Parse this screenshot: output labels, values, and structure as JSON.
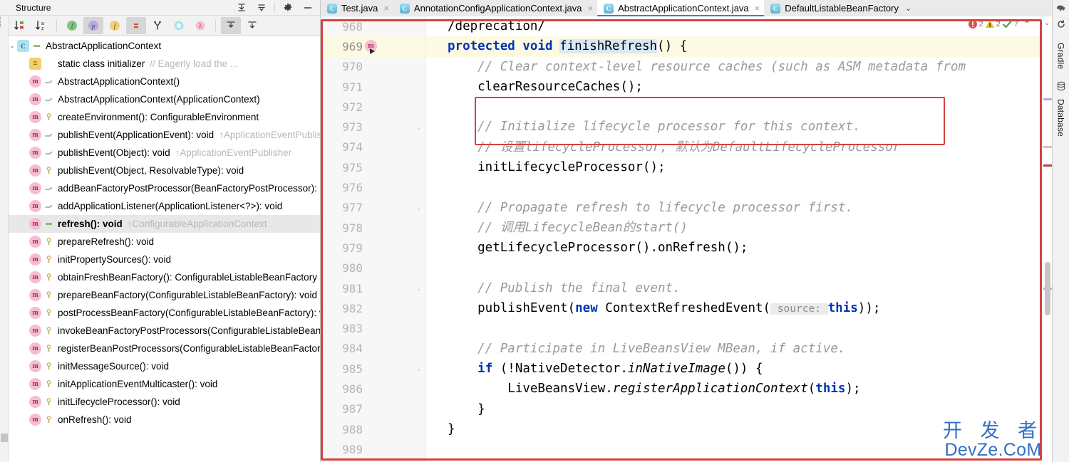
{
  "structure": {
    "title": "Structure",
    "header_actions": [
      {
        "name": "expand-all-icon",
        "glyph": "⇟"
      },
      {
        "name": "collapse-all-icon",
        "glyph": "⇞"
      },
      {
        "name": "settings-gear-icon",
        "glyph": "✲"
      },
      {
        "name": "hide-panel-icon",
        "glyph": "—"
      }
    ],
    "toolbar": [
      {
        "name": "sort-by-visibility-button",
        "glyph": "↓",
        "pressed": false
      },
      {
        "name": "sort-alphabetically-button",
        "glyph": "↓",
        "pressed": false
      },
      {
        "name": "show-inherited-button",
        "glyph": "I",
        "pressed": false
      },
      {
        "name": "show-properties-button",
        "glyph": "p",
        "pressed": true
      },
      {
        "name": "show-fields-button",
        "glyph": "f",
        "pressed": false
      },
      {
        "name": "show-non-public-button",
        "glyph": "=",
        "pressed": true
      },
      {
        "name": "show-anonymous-classes-button",
        "glyph": "Y",
        "pressed": false
      },
      {
        "name": "show-interfaces-button",
        "glyph": "O",
        "pressed": false
      },
      {
        "name": "show-lambdas-button",
        "glyph": "λ",
        "pressed": false
      },
      {
        "name": "expand-all-tree-button",
        "glyph": "⇲",
        "pressed": true
      },
      {
        "name": "collapse-all-tree-button",
        "glyph": "⇱",
        "pressed": false
      }
    ],
    "left_strip_label": "Structure",
    "tree": [
      {
        "kind": "class",
        "mod": "field",
        "label": "AbstractApplicationContext",
        "sub": "",
        "indent": 0,
        "twisty": "v",
        "selected": false
      },
      {
        "kind": "init",
        "mod": "",
        "label": "static class initializer",
        "sub": "// Eagerly load the ...",
        "indent": 1,
        "twisty": "",
        "selected": false
      },
      {
        "kind": "method",
        "mod": "public",
        "label": "AbstractApplicationContext()",
        "sub": "",
        "indent": 1,
        "twisty": "",
        "selected": false
      },
      {
        "kind": "method",
        "mod": "public",
        "label": "AbstractApplicationContext(ApplicationContext)",
        "sub": "",
        "indent": 1,
        "twisty": "",
        "selected": false
      },
      {
        "kind": "method",
        "mod": "prot",
        "label": "createEnvironment(): ConfigurableEnvironment",
        "sub": "",
        "indent": 1,
        "twisty": "",
        "selected": false
      },
      {
        "kind": "method",
        "mod": "public",
        "label": "publishEvent(ApplicationEvent): void",
        "sub": "↑ApplicationEventPublisher",
        "indent": 1,
        "twisty": "",
        "selected": false
      },
      {
        "kind": "method",
        "mod": "public",
        "label": "publishEvent(Object): void",
        "sub": "↑ApplicationEventPublisher",
        "indent": 1,
        "twisty": "",
        "selected": false
      },
      {
        "kind": "method",
        "mod": "prot",
        "label": "publishEvent(Object, ResolvableType): void",
        "sub": "",
        "indent": 1,
        "twisty": "",
        "selected": false
      },
      {
        "kind": "method",
        "mod": "public",
        "label": "addBeanFactoryPostProcessor(BeanFactoryPostProcessor): void",
        "sub": "",
        "indent": 1,
        "twisty": "",
        "selected": false
      },
      {
        "kind": "method",
        "mod": "public",
        "label": "addApplicationListener(ApplicationListener<?>): void",
        "sub": "",
        "indent": 1,
        "twisty": "",
        "selected": false
      },
      {
        "kind": "method",
        "mod": "field",
        "label": "refresh(): void",
        "sub": "↑ConfigurableApplicationContext",
        "indent": 1,
        "twisty": "",
        "selected": true
      },
      {
        "kind": "method",
        "mod": "prot",
        "label": "prepareRefresh(): void",
        "sub": "",
        "indent": 1,
        "twisty": "",
        "selected": false
      },
      {
        "kind": "method",
        "mod": "prot",
        "label": "initPropertySources(): void",
        "sub": "",
        "indent": 1,
        "twisty": "",
        "selected": false
      },
      {
        "kind": "method",
        "mod": "prot",
        "label": "obtainFreshBeanFactory(): ConfigurableListableBeanFactory",
        "sub": "",
        "indent": 1,
        "twisty": "",
        "selected": false
      },
      {
        "kind": "method",
        "mod": "prot",
        "label": "prepareBeanFactory(ConfigurableListableBeanFactory): void",
        "sub": "",
        "indent": 1,
        "twisty": "",
        "selected": false
      },
      {
        "kind": "method",
        "mod": "prot",
        "label": "postProcessBeanFactory(ConfigurableListableBeanFactory): void",
        "sub": "",
        "indent": 1,
        "twisty": "",
        "selected": false
      },
      {
        "kind": "method",
        "mod": "prot",
        "label": "invokeBeanFactoryPostProcessors(ConfigurableListableBeanFactory): void",
        "sub": "",
        "indent": 1,
        "twisty": "",
        "selected": false
      },
      {
        "kind": "method",
        "mod": "prot",
        "label": "registerBeanPostProcessors(ConfigurableListableBeanFactory): void",
        "sub": "",
        "indent": 1,
        "twisty": "",
        "selected": false
      },
      {
        "kind": "method",
        "mod": "prot",
        "label": "initMessageSource(): void",
        "sub": "",
        "indent": 1,
        "twisty": "",
        "selected": false
      },
      {
        "kind": "method",
        "mod": "prot",
        "label": "initApplicationEventMulticaster(): void",
        "sub": "",
        "indent": 1,
        "twisty": "",
        "selected": false
      },
      {
        "kind": "method",
        "mod": "prot",
        "label": "initLifecycleProcessor(): void",
        "sub": "",
        "indent": 1,
        "twisty": "",
        "selected": false
      },
      {
        "kind": "method",
        "mod": "prot",
        "label": "onRefresh(): void",
        "sub": "",
        "indent": 1,
        "twisty": "",
        "selected": false
      }
    ]
  },
  "editor": {
    "tabs": [
      {
        "label": "Test.java",
        "active": false,
        "closable": true,
        "chevron": false
      },
      {
        "label": "AnnotationConfigApplicationContext.java",
        "active": false,
        "closable": true,
        "chevron": false
      },
      {
        "label": "AbstractApplicationContext.java",
        "active": true,
        "closable": true,
        "chevron": false
      },
      {
        "label": "DefaultListableBeanFactory",
        "active": false,
        "closable": false,
        "chevron": true
      }
    ],
    "line_numbers": [
      "968",
      "969",
      "970",
      "971",
      "972",
      "973",
      "974",
      "975",
      "976",
      "977",
      "978",
      "979",
      "980",
      "981",
      "982",
      "983",
      "984",
      "985",
      "986",
      "987",
      "988",
      "989"
    ],
    "current_line_number": "969",
    "gutter_marker": "m",
    "code_lines": [
      {
        "n": "968",
        "current": false,
        "segments": [
          {
            "t": "/deprecation/",
            "c": "plain"
          }
        ]
      },
      {
        "n": "969",
        "current": true,
        "segments": [
          {
            "t": "protected",
            "c": "kw"
          },
          {
            "t": " ",
            "c": "plain"
          },
          {
            "t": "void",
            "c": "kw"
          },
          {
            "t": " ",
            "c": "plain"
          },
          {
            "t": "caret",
            "c": "caret"
          },
          {
            "t": "finishRefresh",
            "c": "sel"
          },
          {
            "t": "() {",
            "c": "plain"
          }
        ]
      },
      {
        "n": "970",
        "current": false,
        "segments": [
          {
            "t": "    // Clear context-level resource caches (such as ASM metadata from",
            "c": "cmt"
          }
        ]
      },
      {
        "n": "971",
        "current": false,
        "segments": [
          {
            "t": "    clearResourceCaches();",
            "c": "plain"
          }
        ]
      },
      {
        "n": "972",
        "current": false,
        "segments": []
      },
      {
        "n": "973",
        "current": false,
        "segments": [
          {
            "t": "    // Initialize lifecycle processor for this context.",
            "c": "cmt"
          }
        ]
      },
      {
        "n": "974",
        "current": false,
        "segments": [
          {
            "t": "    // 设置lifecycleProcessor, 默认为DefaultLifecycleProcessor",
            "c": "cmt"
          }
        ]
      },
      {
        "n": "975",
        "current": false,
        "segments": [
          {
            "t": "    initLifecycleProcessor();",
            "c": "plain"
          }
        ]
      },
      {
        "n": "976",
        "current": false,
        "segments": []
      },
      {
        "n": "977",
        "current": false,
        "segments": [
          {
            "t": "    // Propagate refresh to lifecycle processor first.",
            "c": "cmt"
          }
        ]
      },
      {
        "n": "978",
        "current": false,
        "segments": [
          {
            "t": "    // 调用LifecycleBean的start()",
            "c": "cmt"
          }
        ]
      },
      {
        "n": "979",
        "current": false,
        "segments": [
          {
            "t": "    getLifecycleProcessor().onRefresh();",
            "c": "plain"
          }
        ]
      },
      {
        "n": "980",
        "current": false,
        "segments": []
      },
      {
        "n": "981",
        "current": false,
        "segments": [
          {
            "t": "    // Publish the final event.",
            "c": "cmt"
          }
        ]
      },
      {
        "n": "982",
        "current": false,
        "segments": [
          {
            "t": "    publishEvent(",
            "c": "plain"
          },
          {
            "t": "new",
            "c": "kw"
          },
          {
            "t": " ContextRefreshedEvent(",
            "c": "plain"
          },
          {
            "t": " source: ",
            "c": "hint"
          },
          {
            "t": "this",
            "c": "kw"
          },
          {
            "t": "));",
            "c": "plain"
          }
        ]
      },
      {
        "n": "983",
        "current": false,
        "segments": []
      },
      {
        "n": "984",
        "current": false,
        "segments": [
          {
            "t": "    // Participate in LiveBeansView MBean, if active.",
            "c": "cmt"
          }
        ]
      },
      {
        "n": "985",
        "current": false,
        "segments": [
          {
            "t": "    ",
            "c": "plain"
          },
          {
            "t": "if",
            "c": "kw"
          },
          {
            "t": " (!NativeDetector.",
            "c": "plain"
          },
          {
            "t": "inNativeImage",
            "c": "ital"
          },
          {
            "t": "()) {",
            "c": "plain"
          }
        ]
      },
      {
        "n": "986",
        "current": false,
        "segments": [
          {
            "t": "        LiveBeansView.",
            "c": "plain"
          },
          {
            "t": "registerApplicationContext",
            "c": "ital"
          },
          {
            "t": "(",
            "c": "plain"
          },
          {
            "t": "this",
            "c": "kw"
          },
          {
            "t": ");",
            "c": "plain"
          }
        ]
      },
      {
        "n": "987",
        "current": false,
        "segments": [
          {
            "t": "    }",
            "c": "plain"
          }
        ]
      },
      {
        "n": "988",
        "current": false,
        "segments": [
          {
            "t": "}",
            "c": "plain"
          }
        ]
      },
      {
        "n": "989",
        "current": false,
        "segments": []
      }
    ],
    "inspections": {
      "error_count": "2",
      "warning_count": "2",
      "ok_count": "7",
      "collapse_glyph": "⌃"
    },
    "highlight_color": "#d44242"
  },
  "right_strip": {
    "icons": [
      {
        "name": "gradle-elephant-icon",
        "glyph": "◪"
      },
      {
        "name": "refresh-icon",
        "glyph": "↻"
      }
    ],
    "tabs": [
      {
        "label": "Gradle"
      },
      {
        "label": "Database"
      }
    ]
  },
  "watermark": {
    "cn": "开 发 者",
    "en": "DevZe.CoM",
    "color": "#2f6fc4"
  }
}
